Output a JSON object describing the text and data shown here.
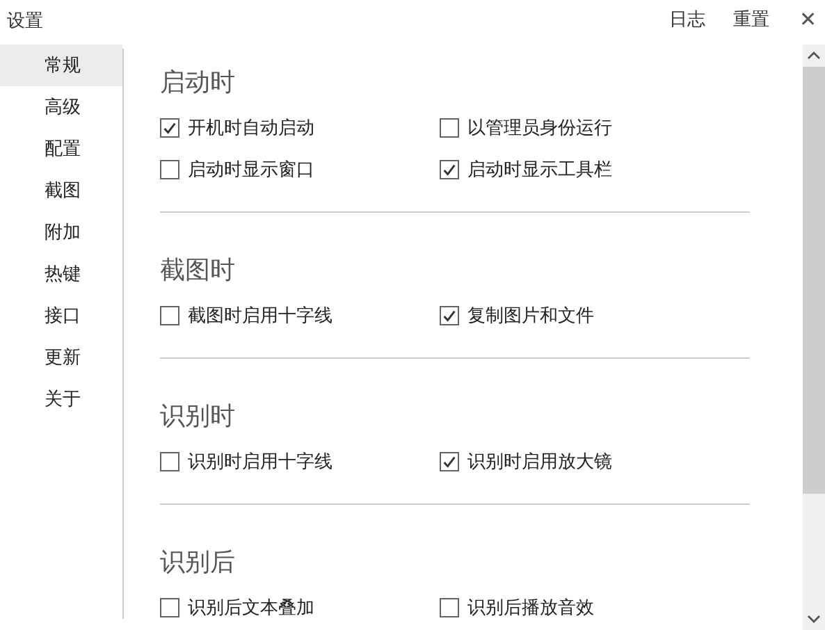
{
  "window": {
    "title": "设置"
  },
  "header_links": [
    {
      "label": "日志"
    },
    {
      "label": "重置"
    }
  ],
  "close": {
    "label": "✕"
  },
  "sidebar": {
    "items": [
      {
        "label": "常规",
        "selected": true
      },
      {
        "label": "高级",
        "selected": false
      },
      {
        "label": "配置",
        "selected": false
      },
      {
        "label": "截图",
        "selected": false
      },
      {
        "label": "附加",
        "selected": false
      },
      {
        "label": "热键",
        "selected": false
      },
      {
        "label": "接口",
        "selected": false
      },
      {
        "label": "更新",
        "selected": false
      },
      {
        "label": "关于",
        "selected": false
      }
    ]
  },
  "sections": [
    {
      "title": "启动时",
      "options": [
        {
          "label": "开机时自动启动",
          "checked": true
        },
        {
          "label": "以管理员身份运行",
          "checked": false
        },
        {
          "label": "启动时显示窗口",
          "checked": false
        },
        {
          "label": "启动时显示工具栏",
          "checked": true
        }
      ]
    },
    {
      "title": "截图时",
      "options": [
        {
          "label": "截图时启用十字线",
          "checked": false
        },
        {
          "label": "复制图片和文件",
          "checked": true
        }
      ]
    },
    {
      "title": "识别时",
      "options": [
        {
          "label": "识别时启用十字线",
          "checked": false
        },
        {
          "label": "识别时启用放大镜",
          "checked": true
        }
      ]
    },
    {
      "title": "识别后",
      "options": [
        {
          "label": "识别后文本叠加",
          "checked": false
        },
        {
          "label": "识别后播放音效",
          "checked": false
        }
      ]
    }
  ]
}
